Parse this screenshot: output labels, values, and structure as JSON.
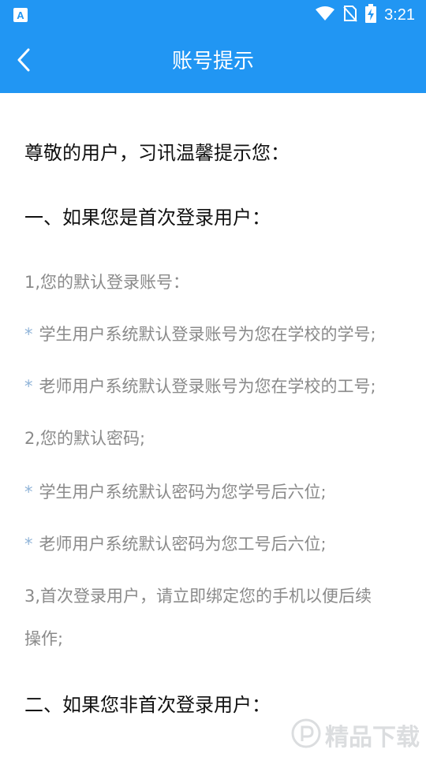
{
  "status_bar": {
    "time": "3:21",
    "icons": [
      "app-notification-icon",
      "wifi-icon",
      "no-sim-icon",
      "battery-charging-icon"
    ]
  },
  "app_bar": {
    "title": "账号提示",
    "back_icon": "chevron-left-icon"
  },
  "content": {
    "greeting": "尊敬的用户，习讯温馨提示您：",
    "section1_title": "一、如果您是首次登录用户：",
    "item1": "1,您的默认登录账号：",
    "item1_b1": "学生用户系统默认登录账号为您在学校的学号;",
    "item1_b2": "老师用户系统默认登录账号为您在学校的工号;",
    "item2": "2,您的默认密码;",
    "item2_b1": "学生用户系统默认密码为您学号后六位;",
    "item2_b2": "老师用户系统默认密码为您工号后六位;",
    "item3_line1": "3,首次登录用户，请立即绑定您的手机以便后续",
    "item3_line2": "操作;",
    "section2_title": "二、如果您非首次登录用户：",
    "bullet_char": "*"
  },
  "watermark": {
    "text": "精品下载"
  },
  "colors": {
    "primary": "#2196F3",
    "heading_text": "#111111",
    "body_text": "#8a8a8a",
    "bullet": "#90b4d8"
  }
}
